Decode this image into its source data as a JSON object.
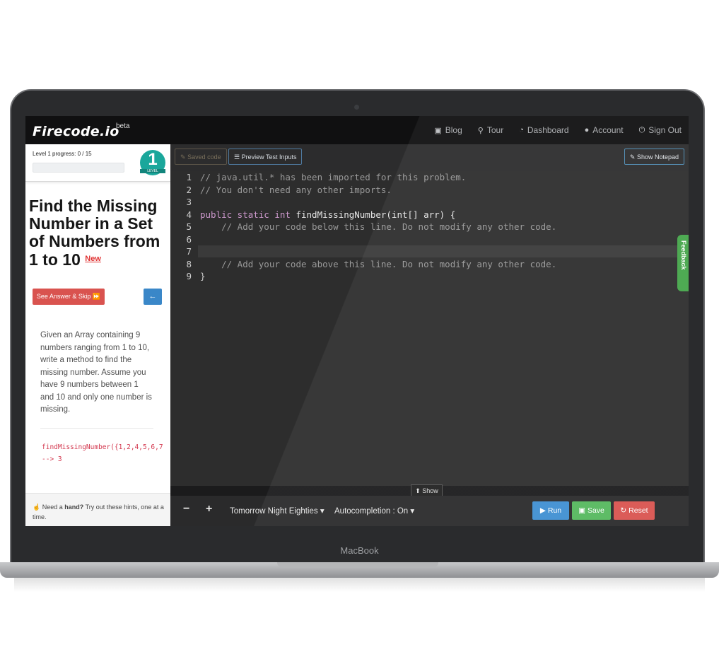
{
  "device": {
    "label": "MacBook"
  },
  "navbar": {
    "logo": "Firecode.io",
    "beta": "beta",
    "links": [
      {
        "label": "Blog",
        "icon": "blog-icon"
      },
      {
        "label": "Tour",
        "icon": "map-pin-icon"
      },
      {
        "label": "Dashboard",
        "icon": "dashboard-icon"
      },
      {
        "label": "Account",
        "icon": "user-icon"
      },
      {
        "label": "Sign Out",
        "icon": "power-icon"
      }
    ]
  },
  "sidebar": {
    "level_progress": "Level 1 progress: 0 / 15",
    "progress_fraction": 0,
    "level_number": "1",
    "level_word": "LEVEL",
    "title": "Find the Missing Number in a Set of Numbers from 1 to 10",
    "new_tag": "New",
    "skip_button": "See Answer & Skip ⏩",
    "back_button": "←",
    "description": "Given an Array containing 9 numbers ranging from 1 to 10, write a method to find the missing number. Assume you have 9 numbers between 1 and 10 and only one number is missing.",
    "example_line1": "findMissingNumber({1,2,4,5,6,7",
    "example_line2": "--> 3",
    "hint_prefix": "Need a ",
    "hint_bold": "hand?",
    "hint_suffix": " Try out these hints, one at a time."
  },
  "editor_toolbar": {
    "saved_code": "Saved code",
    "preview": "Preview Test Inputs",
    "notepad": "Show Notepad"
  },
  "code": {
    "line_numbers": [
      "1",
      "2",
      "3",
      "4",
      "5",
      "6",
      "7",
      "8",
      "9"
    ],
    "l1": "// java.util.* has been imported for this problem.",
    "l2": "// You don't need any other imports.",
    "l4_kw": "public static int",
    "l4_fn": " findMissingNumber(int[] arr) {",
    "l5": "    // Add your code below this line. Do not modify any other code.",
    "l8": "    // Add your code above this line. Do not modify any other code.",
    "l9": "}"
  },
  "show_tab": "Show",
  "bottom_bar": {
    "minus": "−",
    "plus": "+",
    "theme": "Tomorrow Night Eighties",
    "autocompletion": "Autocompletion : On",
    "run": "Run",
    "save": "Save",
    "reset": "Reset"
  },
  "feedback": "Feedback"
}
